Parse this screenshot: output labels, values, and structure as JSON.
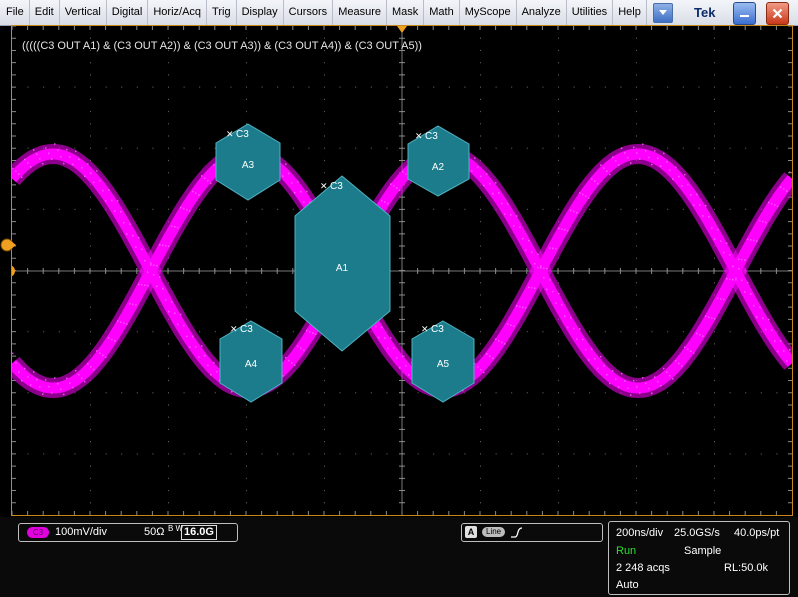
{
  "menu": {
    "items": [
      "File",
      "Edit",
      "Vertical",
      "Digital",
      "Horiz/Acq",
      "Trig",
      "Display",
      "Cursors",
      "Measure",
      "Mask",
      "Math",
      "MyScope",
      "Analyze",
      "Utilities",
      "Help"
    ],
    "brand": "Tek"
  },
  "display": {
    "formula": "(((((C3 OUT A1) & (C3 OUT A2)) & (C3 OUT A3)) & (C3 OUT A4)) & (C3 OUT A5))",
    "trace_color": "#ff00ff",
    "mask_color": "#1c7c8c",
    "frame_color": "#c8871a",
    "masks": [
      {
        "name": "A1",
        "channel": "C3"
      },
      {
        "name": "A2",
        "channel": "C3"
      },
      {
        "name": "A3",
        "channel": "C3"
      },
      {
        "name": "A4",
        "channel": "C3"
      },
      {
        "name": "A5",
        "channel": "C3"
      }
    ]
  },
  "channel": {
    "badge": "C3",
    "scale": "100mV/div",
    "termination": "50Ω",
    "bw_label": "B W",
    "bandwidth": "16.0G",
    "color": "#e000e0"
  },
  "trigger": {
    "source": "A",
    "coupling": "Line",
    "slope_icon": "rising-edge-icon"
  },
  "acquisition": {
    "timebase": "200ns/div",
    "sample_rate": "25.0GS/s",
    "resolution": "40.0ps/pt",
    "state": "Run",
    "mode": "Sample",
    "acqs": "2 248 acqs",
    "record_length": "RL:50.0k",
    "trigger_mode": "Auto",
    "run_color": "#2de02d"
  }
}
